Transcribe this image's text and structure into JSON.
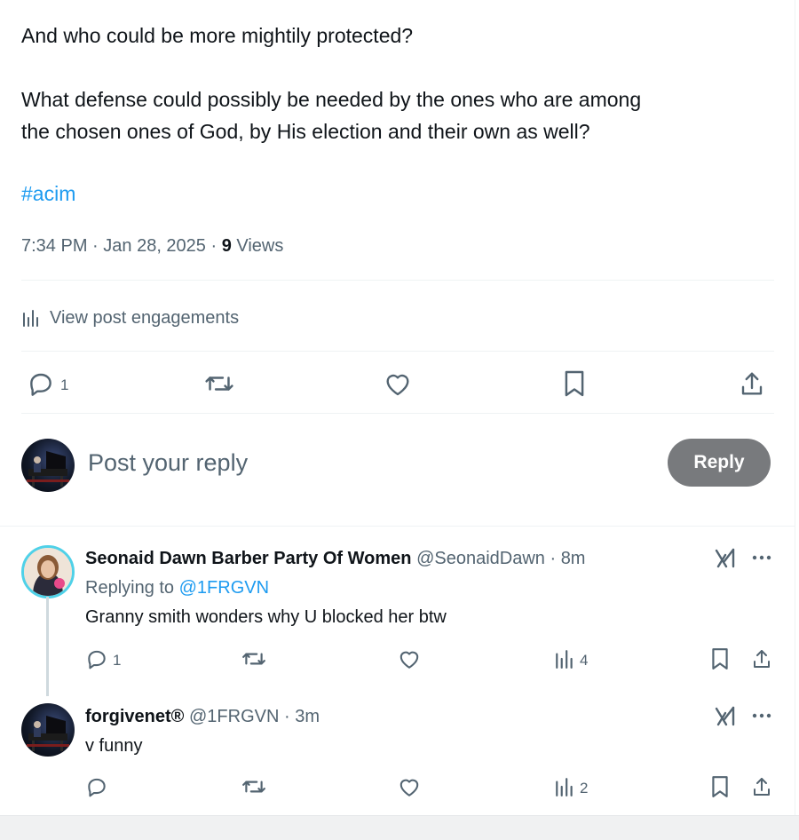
{
  "post": {
    "line1": "And who could be more mightily protected?",
    "line2": "What defense could possibly be needed by the ones who are among",
    "line3": "the chosen ones of God, by His election and their own as well?",
    "hashtag": "#acim",
    "time": "7:34 PM",
    "sep1": " · ",
    "date": "Jan 28, 2025",
    "sep2": " · ",
    "views_count": "9",
    "views_label": " Views"
  },
  "engagements": {
    "label": "View post engagements"
  },
  "actions": {
    "reply_count": "1"
  },
  "reply_box": {
    "placeholder": "Post your reply",
    "button_label": "Reply"
  },
  "comments": [
    {
      "name": "Seonaid Dawn Barber Party Of Women",
      "handle": "@SeonaidDawn",
      "dot": " · ",
      "time": "8m",
      "replying_prefix": "Replying to ",
      "replying_to": "@1FRGVN",
      "text": "Granny smith wonders why U blocked her btw",
      "reply_count": "1",
      "views_count": "4"
    },
    {
      "name": "forgivenet®",
      "handle": "@1FRGVN",
      "dot": " · ",
      "time": "3m",
      "text": "v funny",
      "views_count": "2"
    }
  ],
  "colors": {
    "accent": "#1d9bf0",
    "muted": "#536471",
    "text": "#0f1419",
    "reply_button_bg": "#787a7d"
  },
  "icons": [
    "reply-icon",
    "repost-icon",
    "like-icon",
    "bookmark-icon",
    "share-icon",
    "analytics-icon",
    "grok-icon",
    "more-icon"
  ]
}
